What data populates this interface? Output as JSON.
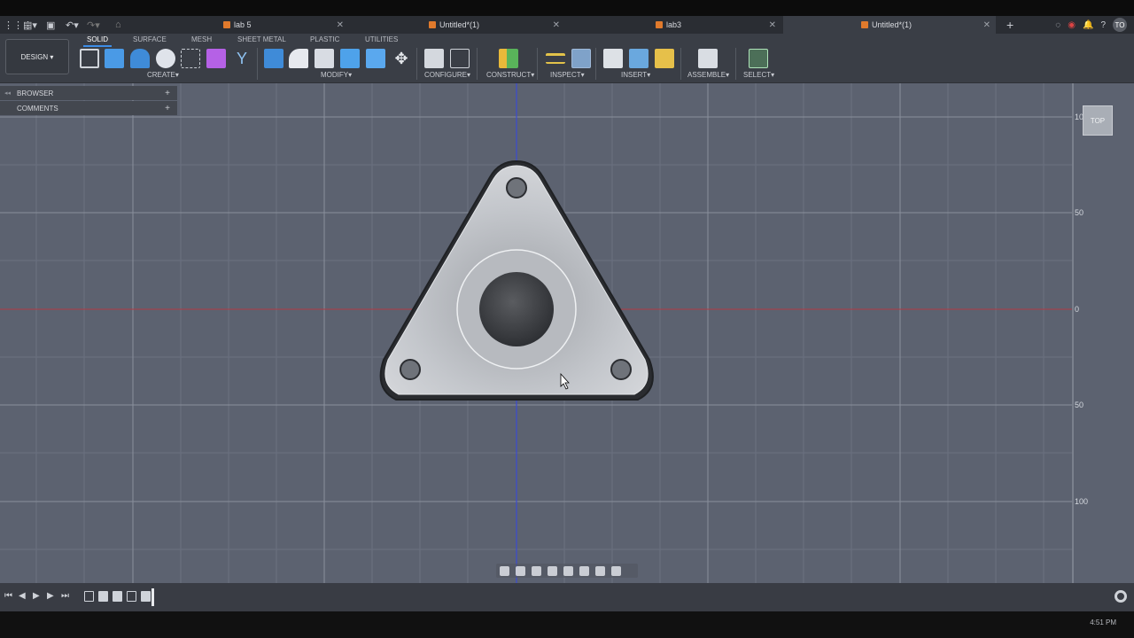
{
  "tabs": [
    {
      "label": "lab 5",
      "active": false
    },
    {
      "label": "Untitled*(1)",
      "active": false
    },
    {
      "label": "lab3",
      "active": false
    },
    {
      "label": "Untitled*(1)",
      "active": true
    }
  ],
  "toolbar": {
    "workspace_button": "DESIGN",
    "workspace_tabs": [
      "SOLID",
      "SURFACE",
      "MESH",
      "SHEET METAL",
      "PLASTIC",
      "UTILITIES"
    ],
    "groups": [
      "CREATE",
      "MODIFY",
      "CONFIGURE",
      "CONSTRUCT",
      "INSPECT",
      "INSERT",
      "ASSEMBLE",
      "SELECT"
    ]
  },
  "panels": {
    "browser": "BROWSER",
    "comments": "COMMENTS"
  },
  "viewcube": {
    "label": "TOP"
  },
  "ruler": {
    "labels": [
      "100",
      "50",
      "0",
      "50",
      "100"
    ]
  },
  "user": {
    "initials": "TO"
  },
  "taskbar": {
    "clock": "4:51 PM"
  },
  "colors": {
    "accent": "#3d8ee8",
    "viewport_bg": "#5c6270",
    "part": "#b9bcc1"
  }
}
